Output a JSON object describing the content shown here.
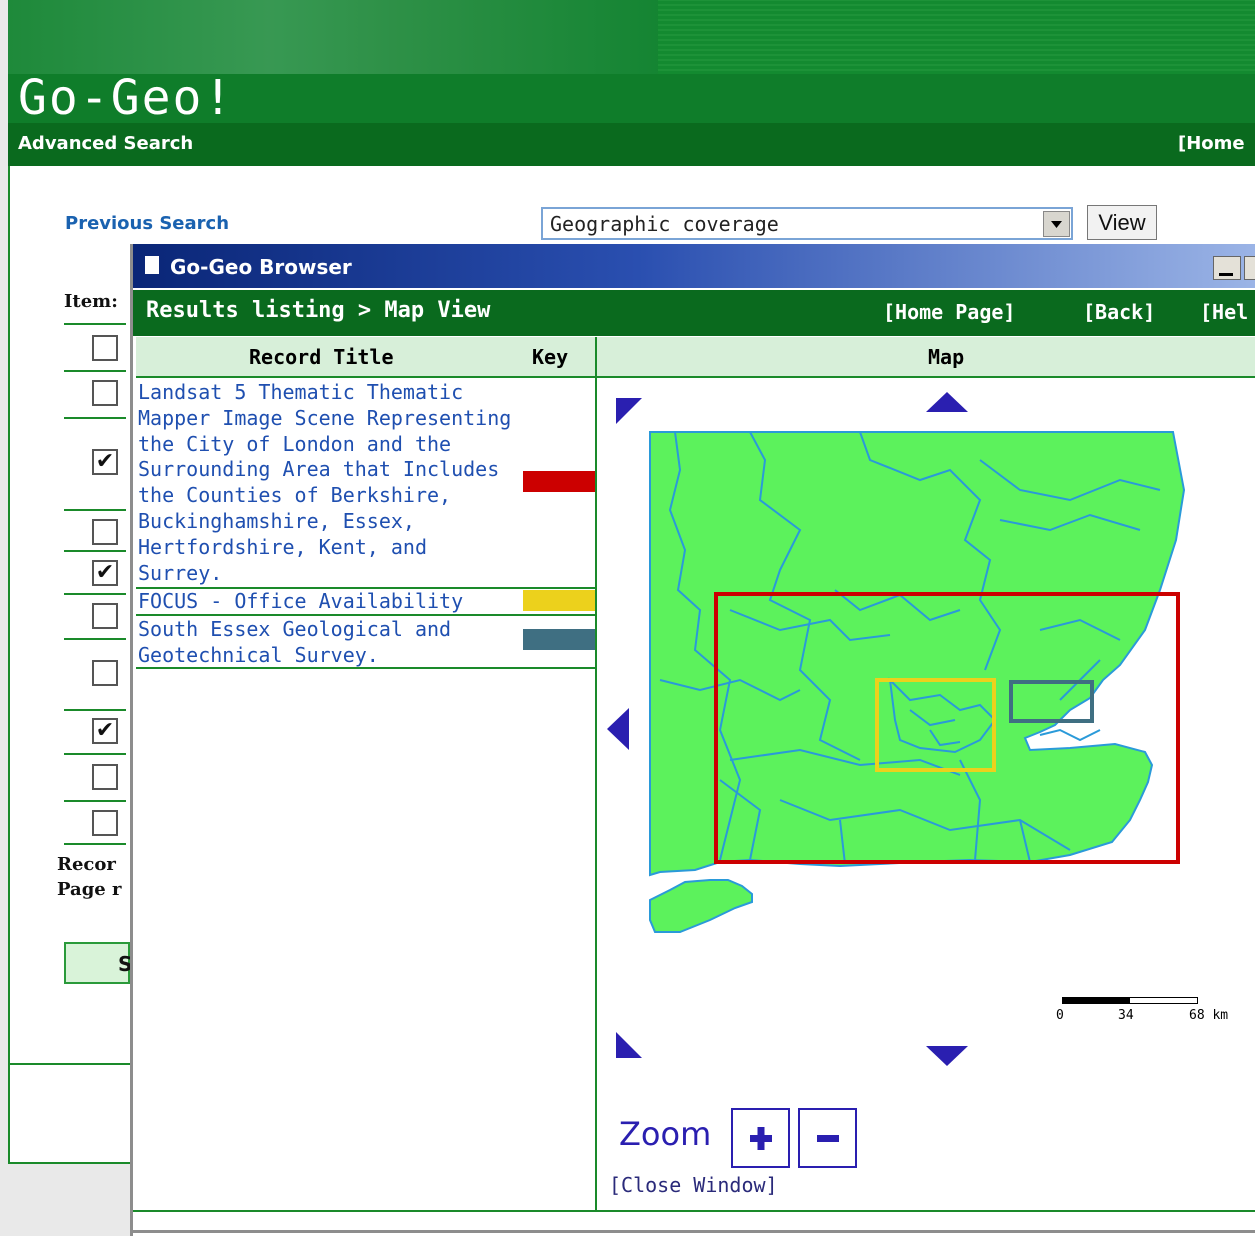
{
  "app": {
    "logo": "Go-Geo!",
    "section_title": "Advanced Search",
    "home_link": "[Home"
  },
  "search_page": {
    "previous_search": "Previous Search",
    "view_select": {
      "selected": "Geographic coverage"
    },
    "view_button": "View",
    "items_label": "Item:",
    "checkboxes": [
      false,
      false,
      true,
      false,
      true,
      false,
      false,
      true,
      false,
      false
    ],
    "records_label_line1": "Recor",
    "records_label_line2": "Page r",
    "submit_label": "S"
  },
  "popup": {
    "window_title": "Go-Geo Browser",
    "breadcrumb": "Results listing > Map View",
    "nav": {
      "home": "[Home Page]",
      "back": "[Back]",
      "help": "[Hel"
    },
    "columns": {
      "record_title": "Record Title",
      "key": "Key",
      "map": "Map"
    },
    "records": [
      {
        "title": "Landsat 5 Thematic Thematic Mapper Image Scene Representing the City of London and the Surrounding Area that Includes the Counties of Berkshire, Buckinghamshire, Essex, Hertfordshire, Kent, and Surrey.",
        "key_color": "#cc0000"
      },
      {
        "title": "FOCUS - Office Availability",
        "key_color": "#ecd11c"
      },
      {
        "title": "South Essex Geological and Geotechnical Survey.",
        "key_color": "#3f6f82"
      }
    ],
    "scale": {
      "labels": [
        "0",
        "34",
        "68 km"
      ]
    },
    "zoom": {
      "label": "Zoom",
      "in_icon": "plus-icon",
      "out_icon": "minus-icon"
    },
    "close_window": "[Close Window]"
  },
  "colors": {
    "brand_green": "#0a6a1e",
    "link_blue": "#1f4fb0",
    "map_land": "#5cf25c",
    "map_border": "#2a9ad9",
    "nav_arrow": "#2a1fb0"
  }
}
